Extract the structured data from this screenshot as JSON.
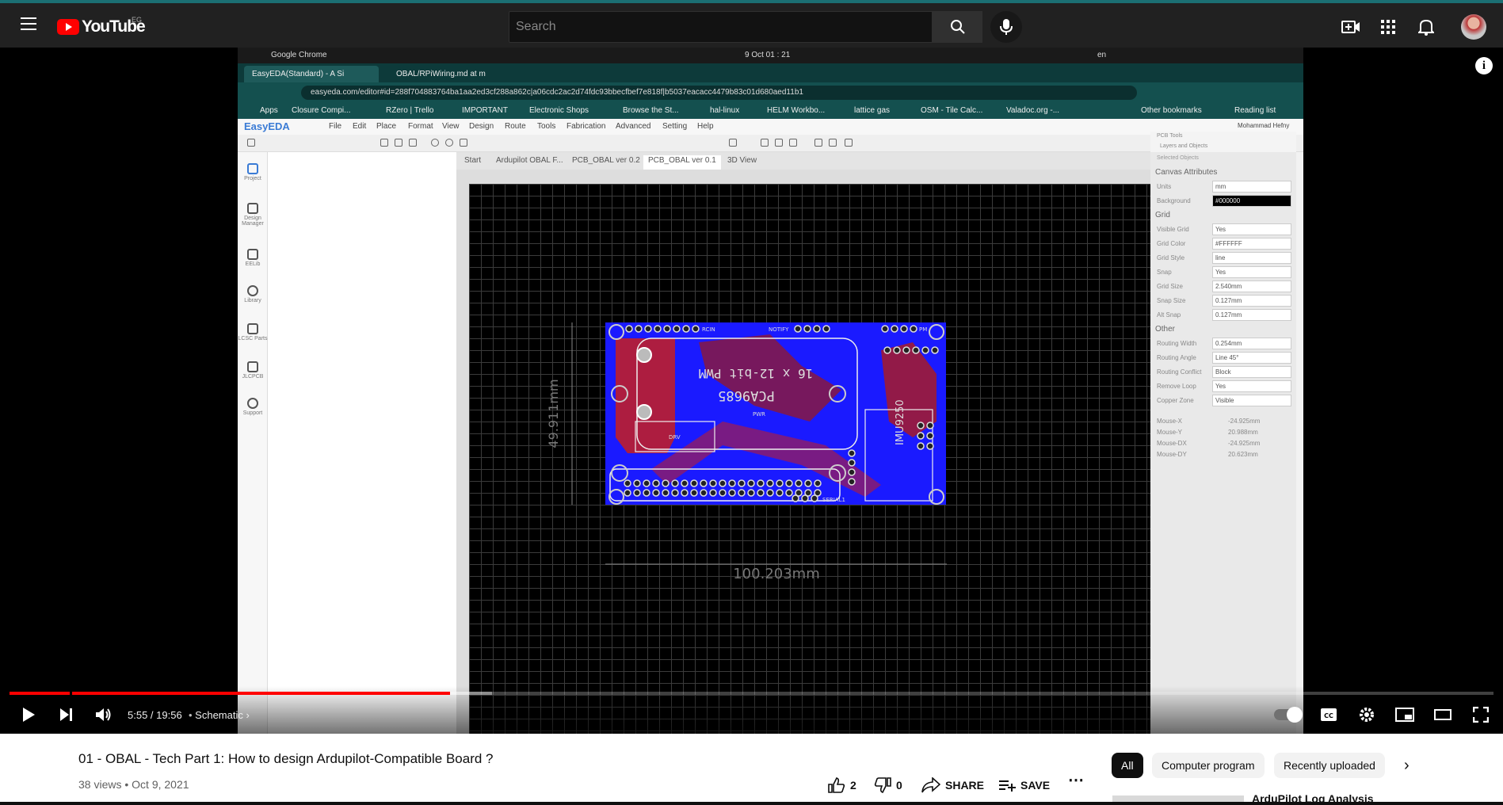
{
  "masthead": {
    "logo_text": "YouTube",
    "country_code": "EG",
    "search_placeholder": "Search"
  },
  "screen": {
    "os_bar": {
      "app": "Google Chrome",
      "clock": "9 Oct 01 : 21",
      "lang": "en"
    },
    "browser_tabs": [
      "EasyEDA(Standard) - A Si",
      "OBAL/RPiWiring.md at m"
    ],
    "url": "easyeda.com/editor#id=288f704883764ba1aa2ed3cf288a862c|a06cdc2ac2d74fdc93bbecfbef7e818f|b5037eacacc4479b83c01d680aed11b1",
    "bookmarks": [
      "Apps",
      "Closure Compi...",
      "RZero | Trello",
      "IMPORTANT",
      "Electronic Shops",
      "Browse the St...",
      "hal-linux",
      "HELM Workbo...",
      "lattice gas",
      "OSM - Tile Calc...",
      "Valadoc.org -...",
      "Other bookmarks",
      "Reading list"
    ],
    "app_menu": [
      "File",
      "Edit",
      "Place",
      "Format",
      "View",
      "Design",
      "Route",
      "Tools",
      "Fabrication",
      "Advanced",
      "Setting",
      "Help"
    ],
    "left_nav": [
      "Project",
      "Design Manager",
      "EELib",
      "Library",
      "LCSC Parts",
      "JLCPCB",
      "Support"
    ],
    "doc_tabs": [
      "Start",
      "Ardupilot OBAL F...",
      "PCB_OBAL ver 0.2",
      "PCB_OBAL ver 0.1",
      "3D View"
    ],
    "pcb": {
      "title_text": "16 x 12-bit PWM",
      "chip_text": "PCA9685",
      "imu_text": "IMU9250",
      "label_rcin": "RCIN",
      "label_notify": "NOTIFY",
      "label_pm": "PM",
      "label_serial1": "SERIAL1",
      "label_drv": "DRV",
      "label_pwr": "PWR",
      "dim_width": "100.203mm",
      "dim_height": "49.911mm"
    },
    "props": {
      "head1": "PCB Tools",
      "head2": "Layers and Objects",
      "selected": "Selected Objects",
      "sections": [
        "Canvas Attributes",
        "Grid",
        "Other"
      ],
      "canvas": [
        [
          "Units",
          "mm"
        ],
        [
          "Background",
          "#000000"
        ]
      ],
      "grid": [
        [
          "Visible Grid",
          "Yes"
        ],
        [
          "Grid Color",
          "#FFFFFF"
        ],
        [
          "Grid Style",
          "line"
        ],
        [
          "Snap",
          "Yes"
        ],
        [
          "Grid Size",
          "2.540mm"
        ],
        [
          "Snap Size",
          "0.127mm"
        ],
        [
          "Alt Snap",
          "0.127mm"
        ]
      ],
      "other": [
        [
          "Routing Width",
          "0.254mm"
        ],
        [
          "Routing Angle",
          "Line 45°"
        ],
        [
          "Routing Conflict",
          "Block"
        ],
        [
          "Remove Loop",
          "Yes"
        ],
        [
          "Copper Zone",
          "Visible"
        ]
      ],
      "mouse": [
        [
          "Mouse-X",
          "-24.925mm"
        ],
        [
          "Mouse-Y",
          "20.988mm"
        ],
        [
          "Mouse-DX",
          "-24.925mm"
        ],
        [
          "Mouse-DY",
          "20.623mm"
        ]
      ],
      "user": "Mohammad Hefny"
    }
  },
  "player": {
    "time": "5:55 / 19:56",
    "chapter": "Schematic",
    "progress_played": 0.297,
    "progress_loaded": 0.325
  },
  "video": {
    "title": "01 - OBAL - Tech Part 1: How to design Ardupilot-Compatible Board ?",
    "meta": "38 views • Oct 9, 2021",
    "likes": "2",
    "dislikes": "0",
    "share": "SHARE",
    "save": "SAVE"
  },
  "chips": [
    "All",
    "Computer program",
    "Recently uploaded"
  ],
  "next_up": "ArduPilot Log Analysis",
  "colors": {
    "pcb_board": "#1a1aff",
    "pcb_copper": "#c81e1e",
    "yt_red": "#ff0000"
  }
}
